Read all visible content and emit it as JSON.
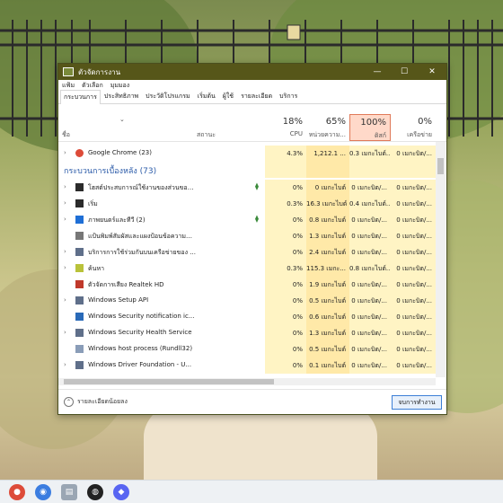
{
  "window": {
    "title": "ตัวจัดการงาน",
    "titlebar_color": "#565619",
    "controls": [
      "—",
      "☐",
      "✕"
    ]
  },
  "menu": [
    "แฟ้ม",
    "ตัวเลือก",
    "มุมมอง"
  ],
  "tabs": [
    {
      "label": "กระบวนการ",
      "active": true
    },
    {
      "label": "ประสิทธิภาพ",
      "active": false
    },
    {
      "label": "ประวัติโปรแกรม",
      "active": false
    },
    {
      "label": "เริ่มต้น",
      "active": false
    },
    {
      "label": "ผู้ใช้",
      "active": false
    },
    {
      "label": "รายละเอียด",
      "active": false
    },
    {
      "label": "บริการ",
      "active": false
    }
  ],
  "header": {
    "name_label": "ชื่อ",
    "status_label": "สถานะ",
    "sort_indicator": "⌄",
    "columns": [
      {
        "pct": "18%",
        "label": "CPU"
      },
      {
        "pct": "65%",
        "label": "หน่วยความ..."
      },
      {
        "pct": "100%",
        "label": "ดิสก์"
      },
      {
        "pct": "0%",
        "label": "เครือข่าย"
      }
    ]
  },
  "groups": {
    "background_title": "กระบวนการเบื้องหลัง (73)"
  },
  "apps": [
    {
      "name": "Google Chrome (23)",
      "cpu": "4.3%",
      "mem": "1,212.1 ...",
      "disk": "0.3 เมกะไบต์...",
      "net": "0 เมกะบิต/...",
      "icon": "chrome-icon"
    }
  ],
  "processes": [
    {
      "name": "โฮสต์ประสบการณ์ใช้งานของส่วนของ W...",
      "cpu": "0%",
      "mem": "0 เมกะไบต์",
      "disk": "0 เมกะบิต/...",
      "net": "0 เมกะบิต/...",
      "expandable": true,
      "leaf": true,
      "icon": "window-host-icon"
    },
    {
      "name": "เริ่ม",
      "cpu": "0.3%",
      "mem": "16.3 เมกะไบต์",
      "disk": "0.4 เมกะไบต์...",
      "net": "0 เมกะบิต/...",
      "expandable": true,
      "leaf": false,
      "icon": "start-icon"
    },
    {
      "name": "ภาพยนตร์และทีวี (2)",
      "cpu": "0%",
      "mem": "0.8 เมกะไบต์",
      "disk": "0 เมกะบิต/...",
      "net": "0 เมกะบิต/...",
      "expandable": true,
      "leaf": true,
      "icon": "movies-tv-icon"
    },
    {
      "name": "แป้นพิมพ์สัมผัสและแผงป้อนข้อความลายมื...",
      "cpu": "0%",
      "mem": "1.3 เมกะไบต์",
      "disk": "0 เมกะบิต/...",
      "net": "0 เมกะบิต/...",
      "expandable": false,
      "leaf": false,
      "icon": "keyboard-icon"
    },
    {
      "name": "บริการการใช้ร่วมกันบนเครือข่ายของ ...",
      "cpu": "0%",
      "mem": "2.4 เมกะไบต์",
      "disk": "0 เมกะบิต/...",
      "net": "0 เมกะบิต/...",
      "expandable": true,
      "leaf": false,
      "icon": "service-icon"
    },
    {
      "name": "ค้นหา",
      "cpu": "0.3%",
      "mem": "115.3 เมกะ...",
      "disk": "0.8 เมกะไบต์...",
      "net": "0 เมกะบิต/...",
      "expandable": true,
      "leaf": false,
      "icon": "search-app-icon"
    },
    {
      "name": "ตัวจัดการเสียง Realtek HD",
      "cpu": "0%",
      "mem": "1.9 เมกะไบต์",
      "disk": "0 เมกะบิต/...",
      "net": "0 เมกะบิต/...",
      "expandable": false,
      "leaf": false,
      "icon": "speaker-icon"
    },
    {
      "name": "Windows Setup API",
      "cpu": "0%",
      "mem": "0.5 เมกะไบต์",
      "disk": "0 เมกะบิต/...",
      "net": "0 เมกะบิต/...",
      "expandable": true,
      "leaf": false,
      "icon": "service-icon"
    },
    {
      "name": "Windows Security notification ic...",
      "cpu": "0%",
      "mem": "0.6 เมกะไบต์",
      "disk": "0 เมกะบิต/...",
      "net": "0 เมกะบิต/...",
      "expandable": false,
      "leaf": false,
      "icon": "security-icon"
    },
    {
      "name": "Windows Security Health Service",
      "cpu": "0%",
      "mem": "1.3 เมกะไบต์",
      "disk": "0 เมกะบิต/...",
      "net": "0 เมกะบิต/...",
      "expandable": true,
      "leaf": false,
      "icon": "service-icon"
    },
    {
      "name": "Windows host process (Rundll32)",
      "cpu": "0%",
      "mem": "0.5 เมกะไบต์",
      "disk": "0 เมกะบิต/...",
      "net": "0 เมกะบิต/...",
      "expandable": false,
      "leaf": false,
      "icon": "document-icon"
    },
    {
      "name": "Windows Driver Foundation - U...",
      "cpu": "0%",
      "mem": "0.1 เมกะไบต์",
      "disk": "0 เมกะบิต/...",
      "net": "0 เมกะบิต/...",
      "expandable": true,
      "leaf": false,
      "icon": "service-icon"
    }
  ],
  "footer": {
    "less_details": "รายละเอียดน้อยลง",
    "end_task": "จบการทำงาน"
  },
  "colors": {
    "cpu_col_bg": "#fff4c4",
    "mem_col_bg": "#ffe9a8",
    "disk_header_bg": "#ffd9c9",
    "disk_header_border": "#e07a5a",
    "group_title": "#2a5aa8"
  },
  "taskbar": [
    "chrome-icon",
    "edge-icon",
    "photos-icon",
    "obs-icon",
    "discord-icon"
  ]
}
